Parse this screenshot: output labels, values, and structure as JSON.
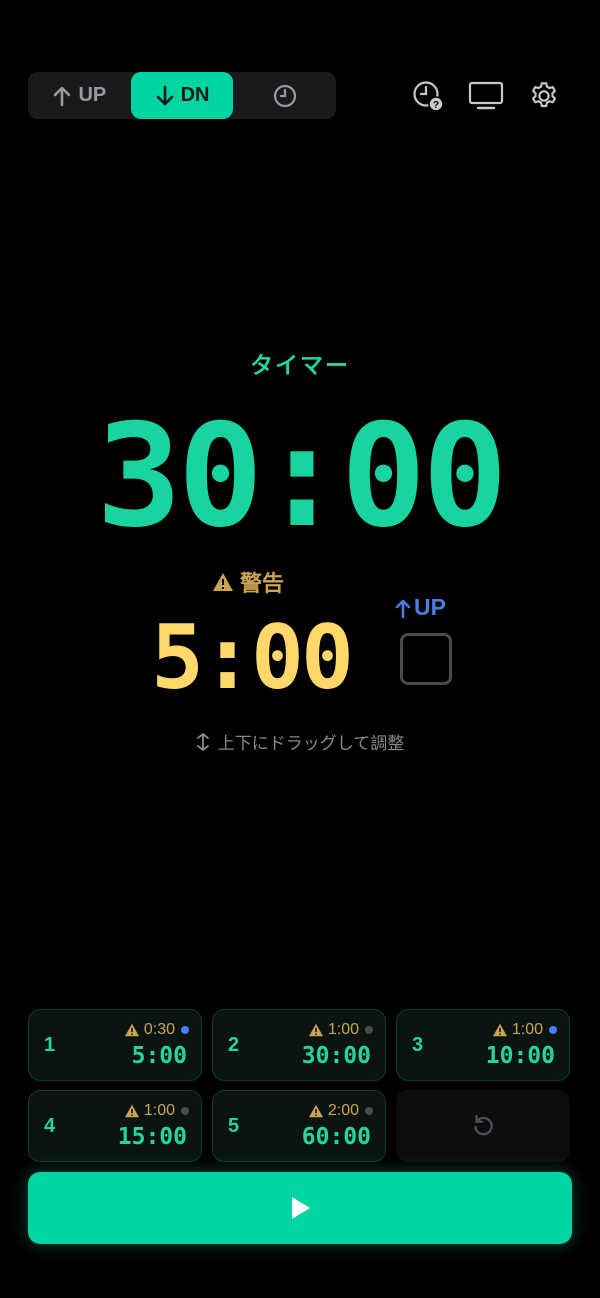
{
  "mode_tabs": [
    {
      "label": "UP",
      "icon": "arrow-up-icon",
      "active": false
    },
    {
      "label": "DN",
      "icon": "arrow-down-icon",
      "active": true
    },
    {
      "label": "",
      "icon": "clock-icon",
      "active": false
    }
  ],
  "header_icons": [
    "clock-help-icon",
    "monitor-icon",
    "gear-icon"
  ],
  "timer": {
    "mode_label": "タイマー",
    "time": "30:00"
  },
  "warning": {
    "label": "警告",
    "time": "5:00"
  },
  "count_up": {
    "label": "UP",
    "checked": false
  },
  "drag_hint": "上下にドラッグして調整",
  "presets": [
    {
      "num": "1",
      "warn": "0:30",
      "time": "5:00",
      "dot_color": "#4a7fe8"
    },
    {
      "num": "2",
      "warn": "1:00",
      "time": "30:00",
      "dot_color": "#4a4a4e"
    },
    {
      "num": "3",
      "warn": "1:00",
      "time": "10:00",
      "dot_color": "#4a7fe8"
    },
    {
      "num": "4",
      "warn": "1:00",
      "time": "15:00",
      "dot_color": "#4a4a4e"
    },
    {
      "num": "5",
      "warn": "2:00",
      "time": "60:00",
      "dot_color": "#4a4a4e"
    }
  ],
  "reset_icon": "reset-icon",
  "start_icon": "play-icon",
  "colors": {
    "accent": "#00d4a0",
    "warning": "#ffd76a",
    "up_blue": "#4a7fe0"
  }
}
